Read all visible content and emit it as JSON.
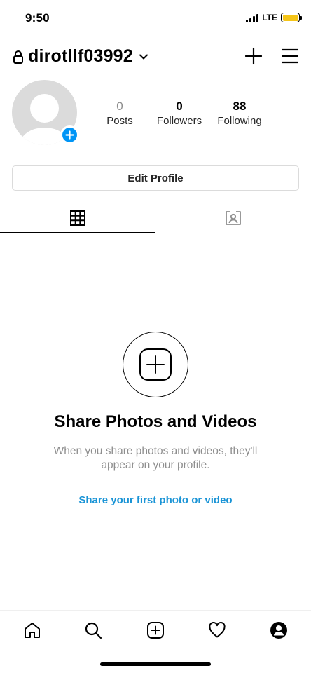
{
  "status_bar": {
    "time": "9:50",
    "network": "LTE",
    "battery_color": "#f5c518"
  },
  "header": {
    "username": "dirotllf03992",
    "lock_icon": "lock-icon",
    "dropdown_icon": "chevron-down-icon",
    "new_post_icon": "plus-icon",
    "menu_icon": "hamburger-menu-icon"
  },
  "profile": {
    "stats": [
      {
        "value": "0",
        "label": "Posts"
      },
      {
        "value": "0",
        "label": "Followers"
      },
      {
        "value": "88",
        "label": "Following"
      }
    ],
    "edit_profile_label": "Edit Profile",
    "add_story_icon": "plus-icon",
    "add_story_color": "#0095f6"
  },
  "tabs": [
    {
      "icon": "grid-icon",
      "active": true
    },
    {
      "icon": "tagged-person-icon",
      "active": false
    }
  ],
  "empty_state": {
    "title": "Share Photos and Videos",
    "subtitle": "When you share photos and videos, they'll appear on your profile.",
    "cta": "Share your first photo or video",
    "cta_color": "#1a94d6"
  },
  "bottom_nav": [
    {
      "icon": "home-icon"
    },
    {
      "icon": "search-icon"
    },
    {
      "icon": "new-post-icon"
    },
    {
      "icon": "heart-icon"
    },
    {
      "icon": "profile-icon"
    }
  ]
}
